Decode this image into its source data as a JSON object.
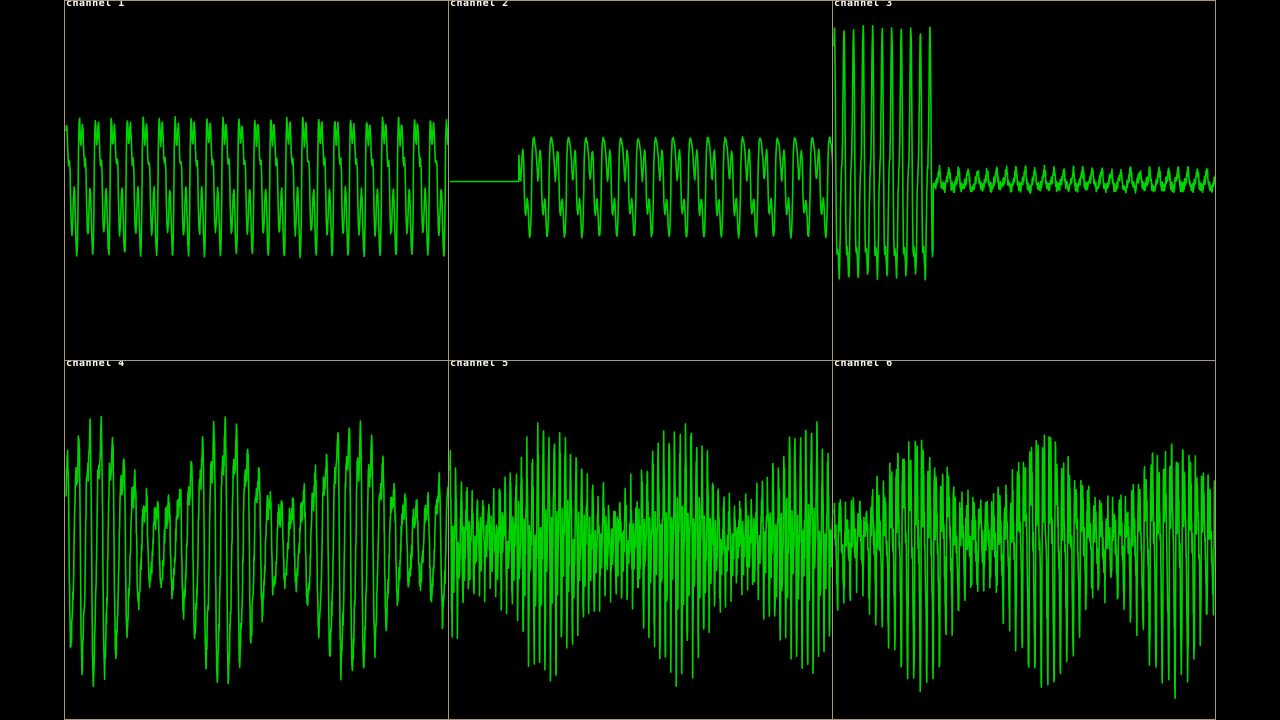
{
  "colors": {
    "background": "#000000",
    "trace": "#00d400",
    "border": "#a8997a",
    "label": "#ffffff"
  },
  "chart_data": [
    {
      "type": "line",
      "label": "channel 1",
      "waveform": {
        "kind": "periodic-spiky",
        "cycles": 24,
        "amplitude": 0.44,
        "harmonics": 5,
        "silence_until": 0,
        "burst_until": 0,
        "noise": 0.04,
        "offset": 0.0,
        "seed": 11
      }
    },
    {
      "type": "line",
      "label": "channel 2",
      "waveform": {
        "kind": "periodic-spiky",
        "cycles": 22,
        "amplitude": 0.31,
        "harmonics": 4,
        "silence_until": 0.18,
        "burst_until": 0,
        "noise": 0.03,
        "offset": 0.0,
        "seed": 23
      }
    },
    {
      "type": "line",
      "label": "channel 3",
      "waveform": {
        "kind": "decay",
        "cycles": 40,
        "amplitude": 0.55,
        "harmonics": 3,
        "silence_until": 0,
        "burst_until": 0.26,
        "noise": 0.05,
        "offset": 0.0,
        "seed": 37
      }
    },
    {
      "type": "line",
      "label": "channel 4",
      "waveform": {
        "kind": "noisy",
        "cycles": 34,
        "amplitude": 0.62,
        "harmonics": 3,
        "silence_until": 0,
        "burst_until": 0,
        "noise": 0.1,
        "offset": 0.0,
        "seed": 41
      }
    },
    {
      "type": "line",
      "label": "channel 5",
      "waveform": {
        "kind": "noisy",
        "cycles": 70,
        "amplitude": 0.6,
        "harmonics": 4,
        "silence_until": 0,
        "burst_until": 0,
        "noise": 0.22,
        "offset": 0.0,
        "seed": 53
      }
    },
    {
      "type": "line",
      "label": "channel 6",
      "waveform": {
        "kind": "noisy",
        "cycles": 60,
        "amplitude": 0.62,
        "harmonics": 4,
        "silence_until": 0,
        "burst_until": 0,
        "noise": 0.18,
        "offset": 0.0,
        "seed": 67
      }
    }
  ]
}
